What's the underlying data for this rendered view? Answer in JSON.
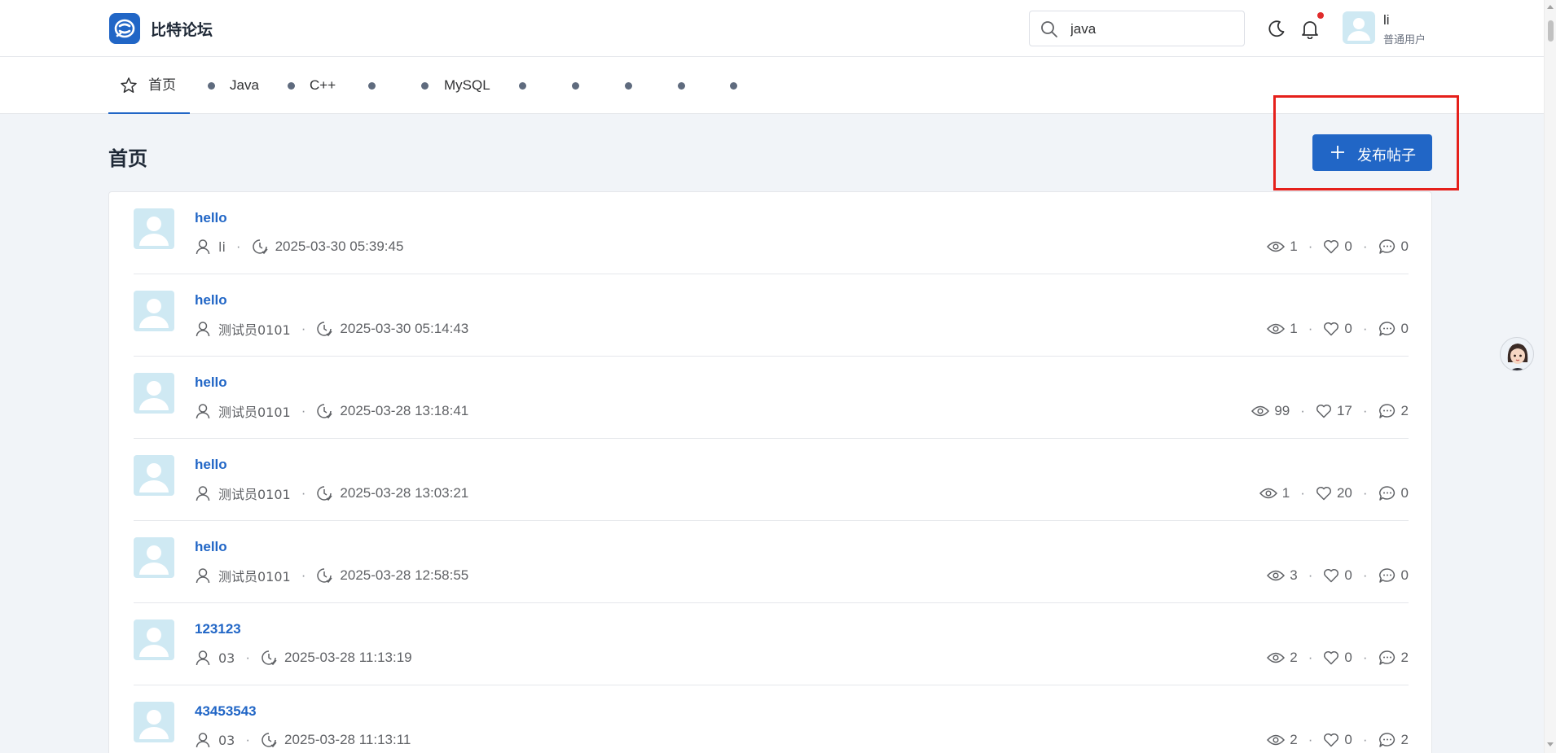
{
  "header": {
    "brand": "比特论坛",
    "search_value": "java",
    "user": {
      "name": "li",
      "role": "普通用户"
    },
    "has_notification": true
  },
  "nav": {
    "items": [
      {
        "label": "首页",
        "icon": "star-icon",
        "active": true
      },
      {
        "label": "Java",
        "icon": "dot"
      },
      {
        "label": "C++",
        "icon": "dot"
      },
      {
        "label": "",
        "icon": "dot"
      },
      {
        "label": "MySQL",
        "icon": "dot"
      },
      {
        "label": "",
        "icon": "dot"
      },
      {
        "label": "",
        "icon": "dot"
      },
      {
        "label": "",
        "icon": "dot"
      },
      {
        "label": "",
        "icon": "dot"
      },
      {
        "label": "",
        "icon": "dot"
      }
    ]
  },
  "page": {
    "title": "首页",
    "publish_label": "发布帖子"
  },
  "posts": [
    {
      "title": "hello",
      "author": "li",
      "time": "2025-03-30 05:39:45",
      "views": "1",
      "likes": "0",
      "comments": "0"
    },
    {
      "title": "hello",
      "author": "测试员0101",
      "time": "2025-03-30 05:14:43",
      "views": "1",
      "likes": "0",
      "comments": "0"
    },
    {
      "title": "hello",
      "author": "测试员0101",
      "time": "2025-03-28 13:18:41",
      "views": "99",
      "likes": "17",
      "comments": "2"
    },
    {
      "title": "hello",
      "author": "测试员0101",
      "time": "2025-03-28 13:03:21",
      "views": "1",
      "likes": "20",
      "comments": "0"
    },
    {
      "title": "hello",
      "author": "测试员0101",
      "time": "2025-03-28 12:58:55",
      "views": "3",
      "likes": "0",
      "comments": "0"
    },
    {
      "title": "123123",
      "author": "03",
      "time": "2025-03-28 11:13:19",
      "views": "2",
      "likes": "0",
      "comments": "2"
    },
    {
      "title": "43453543",
      "author": "03",
      "time": "2025-03-28 11:13:11",
      "views": "2",
      "likes": "0",
      "comments": "2"
    }
  ],
  "separator": "·",
  "colors": {
    "accent": "#2166c6",
    "highlight": "#e5201b",
    "notification": "#e02b2b"
  }
}
